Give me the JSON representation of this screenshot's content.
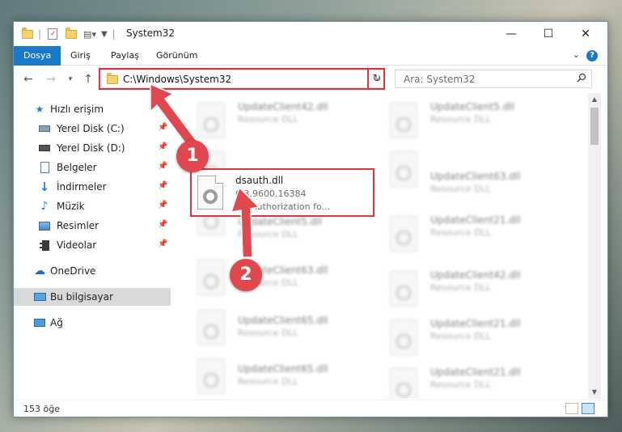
{
  "window": {
    "title": "System32",
    "tabs": [
      {
        "label": "Dosya",
        "active": true
      },
      {
        "label": "Giriş"
      },
      {
        "label": "Paylaş"
      },
      {
        "label": "Görünüm"
      }
    ],
    "help_label": "?"
  },
  "address": {
    "path": "C:\\Windows\\System32",
    "search_placeholder": "Ara: System32"
  },
  "sidebar": {
    "quick_access": "Hızlı erişim",
    "items": [
      {
        "label": "Yerel Disk (C:)",
        "icon": "drive-icon",
        "pinned": true
      },
      {
        "label": "Yerel Disk (D:)",
        "icon": "drive-icon",
        "pinned": true
      },
      {
        "label": "Belgeler",
        "icon": "documents-icon",
        "pinned": true
      },
      {
        "label": "İndirmeler",
        "icon": "downloads-icon",
        "pinned": true
      },
      {
        "label": "Müzik",
        "icon": "music-icon",
        "pinned": true
      },
      {
        "label": "Resimler",
        "icon": "pictures-icon",
        "pinned": true
      },
      {
        "label": "Videolar",
        "icon": "videos-icon",
        "pinned": true
      }
    ],
    "onedrive": "OneDrive",
    "this_pc": "Bu bilgisayar",
    "network": "Ağ"
  },
  "files": {
    "highlighted": {
      "name": "dsauth.dll",
      "version": "6.3.9600.16384",
      "description": "DS Authorization fo..."
    },
    "left_column": [
      {
        "name": "UpdateClient42.dll",
        "desc": "Resource DLL"
      },
      {
        "name": "UpdateClient5.dll",
        "desc": "Resource DLL"
      },
      {
        "name": "UpdateClient63.dll",
        "desc": "Resource DLL"
      },
      {
        "name": "UpdateClient65.dll",
        "desc": "Resource DLL"
      },
      {
        "name": "UpdateClient65.dll",
        "desc": "Resource DLL"
      }
    ],
    "right_column": [
      {
        "name": "UpdateClient5.dll",
        "desc": "Resource DLL"
      },
      {
        "name": "UpdateClient63.dll",
        "desc": "Resource DLL"
      },
      {
        "name": "UpdateClient21.dll",
        "desc": "Resource DLL"
      },
      {
        "name": "UpdateClient42.dll",
        "desc": "Resource DLL"
      },
      {
        "name": "UpdateClient21.dll",
        "desc": "Resource DLL"
      },
      {
        "name": "UpdateClient21.dll",
        "desc": "Resource DLL"
      }
    ]
  },
  "status": {
    "item_count": "153 öğe"
  },
  "annotations": {
    "step1": "1",
    "step2": "2",
    "color": "#e0474f"
  }
}
